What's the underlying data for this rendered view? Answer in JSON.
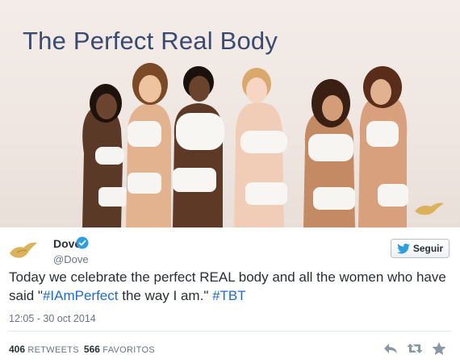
{
  "photo": {
    "title": "The Perfect Real Body"
  },
  "author": {
    "name": "Dove",
    "handle": "@Dove"
  },
  "follow_label": "Seguir",
  "tweet": {
    "text_1": "Today we celebrate the perfect REAL body and all the women who have said \"",
    "hashtag_1": "#IAmPerfect",
    "text_2": " the way I am.\" ",
    "hashtag_2": "#TBT",
    "timestamp": "12:05 - 30 oct 2014"
  },
  "stats": {
    "retweets_count": "406",
    "retweets_label": "RETWEETS",
    "favorites_count": "566",
    "favorites_label": "FAVORITOS"
  },
  "icons": [
    "dove-logo-icon",
    "verified-icon",
    "twitter-bird-icon",
    "reply-icon",
    "retweet-icon",
    "favorite-icon"
  ],
  "colors": {
    "link": "#1b6bd8",
    "verified": "#2d9ee0",
    "title": "#3a4a70",
    "brand_gold": "#d9b25a"
  }
}
